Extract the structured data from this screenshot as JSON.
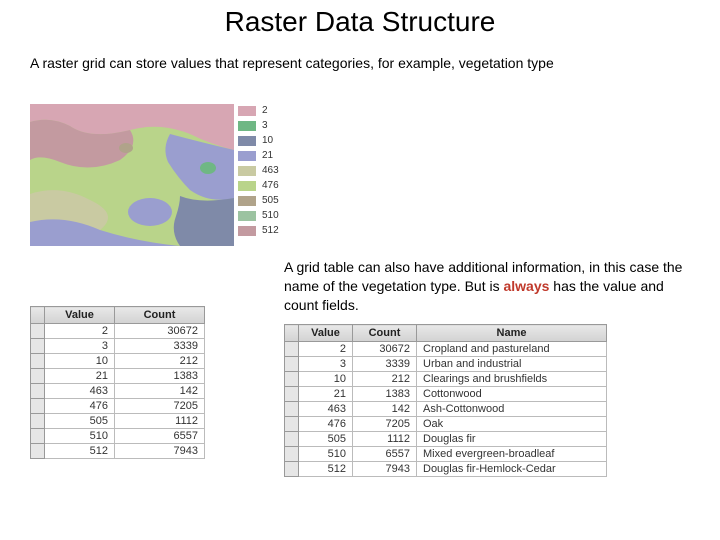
{
  "title": "Raster Data Structure",
  "intro": "A raster grid can store values that represent categories, for example, vegetation type",
  "para2_pre": "A grid table can also have additional information, in this case the name of the vegetation type. But is ",
  "para2_hl": "always",
  "para2_post": " has the value and count fields.",
  "legend": [
    {
      "v": "2",
      "c": "#d7a6b3"
    },
    {
      "v": "3",
      "c": "#6fb784"
    },
    {
      "v": "10",
      "c": "#7f8aa8"
    },
    {
      "v": "21",
      "c": "#9a9ecf"
    },
    {
      "v": "463",
      "c": "#c9caa2"
    },
    {
      "v": "476",
      "c": "#b9d48a"
    },
    {
      "v": "505",
      "c": "#b0a38a"
    },
    {
      "v": "510",
      "c": "#9cc3a1"
    },
    {
      "v": "512",
      "c": "#c39aa0"
    }
  ],
  "table1": {
    "headers": [
      "Value",
      "Count"
    ],
    "rows": [
      [
        "2",
        "30672"
      ],
      [
        "3",
        "3339"
      ],
      [
        "10",
        "212"
      ],
      [
        "21",
        "1383"
      ],
      [
        "463",
        "142"
      ],
      [
        "476",
        "7205"
      ],
      [
        "505",
        "1112"
      ],
      [
        "510",
        "6557"
      ],
      [
        "512",
        "7943"
      ]
    ]
  },
  "table2": {
    "headers": [
      "Value",
      "Count",
      "Name"
    ],
    "rows": [
      [
        "2",
        "30672",
        "Cropland and pastureland"
      ],
      [
        "3",
        "3339",
        "Urban and industrial"
      ],
      [
        "10",
        "212",
        "Clearings and brushfields"
      ],
      [
        "21",
        "1383",
        "Cottonwood"
      ],
      [
        "463",
        "142",
        "Ash-Cottonwood"
      ],
      [
        "476",
        "7205",
        "Oak"
      ],
      [
        "505",
        "1112",
        "Douglas fir"
      ],
      [
        "510",
        "6557",
        "Mixed evergreen-broadleaf"
      ],
      [
        "512",
        "7943",
        "Douglas fir-Hemlock-Cedar"
      ]
    ]
  },
  "chart_data": {
    "type": "table",
    "title": "Raster attribute table",
    "columns": [
      "Value",
      "Count",
      "Name"
    ],
    "rows": [
      [
        2,
        30672,
        "Cropland and pastureland"
      ],
      [
        3,
        3339,
        "Urban and industrial"
      ],
      [
        10,
        212,
        "Clearings and brushfields"
      ],
      [
        21,
        1383,
        "Cottonwood"
      ],
      [
        463,
        142,
        "Ash-Cottonwood"
      ],
      [
        476,
        7205,
        "Oak"
      ],
      [
        505,
        1112,
        "Douglas fir"
      ],
      [
        510,
        6557,
        "Mixed evergreen-broadleaf"
      ],
      [
        512,
        7943,
        "Douglas fir-Hemlock-Cedar"
      ]
    ]
  }
}
